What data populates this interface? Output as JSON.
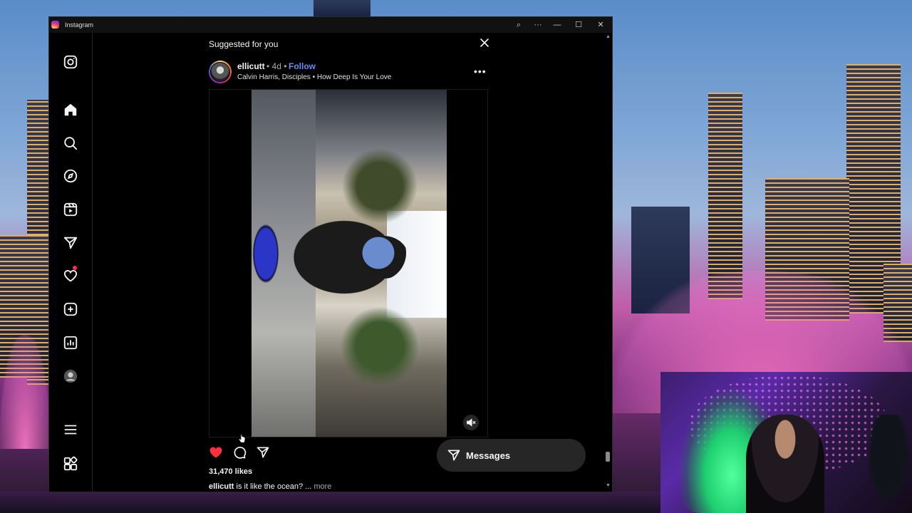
{
  "window": {
    "title": "Instagram",
    "controls": {
      "zoom": "⌕",
      "more": "···",
      "minimize": "—",
      "maximize": "☐",
      "close": "✕"
    }
  },
  "sidebar": {
    "items": [
      {
        "icon": "instagram-logo-icon"
      },
      {
        "icon": "home-icon"
      },
      {
        "icon": "search-icon"
      },
      {
        "icon": "explore-compass-icon"
      },
      {
        "icon": "reels-icon"
      },
      {
        "icon": "messages-send-icon"
      },
      {
        "icon": "notifications-heart-icon",
        "has_dot": true
      },
      {
        "icon": "create-plus-icon"
      },
      {
        "icon": "dashboard-icon"
      },
      {
        "icon": "profile-avatar-icon"
      },
      {
        "icon": "menu-hamburger-icon"
      },
      {
        "icon": "also-from-meta-icon"
      }
    ]
  },
  "suggested": {
    "title": "Suggested for you"
  },
  "post": {
    "username": "ellicutt",
    "age": "• 4d •",
    "follow_label": "Follow",
    "audio": "Calvin Harris, Disciples • How Deep Is Your Love",
    "more_label": "•••",
    "likes": "31,470 likes",
    "caption_user": "ellicutt",
    "caption_text": " is it like the ocean? ... ",
    "caption_more": "more",
    "liked": true,
    "like_color": "#ff3040"
  },
  "messages": {
    "label": "Messages"
  },
  "colors": {
    "accent_blue": "#6b8cf7",
    "background": "#000000",
    "text": "#f5f5f5"
  }
}
